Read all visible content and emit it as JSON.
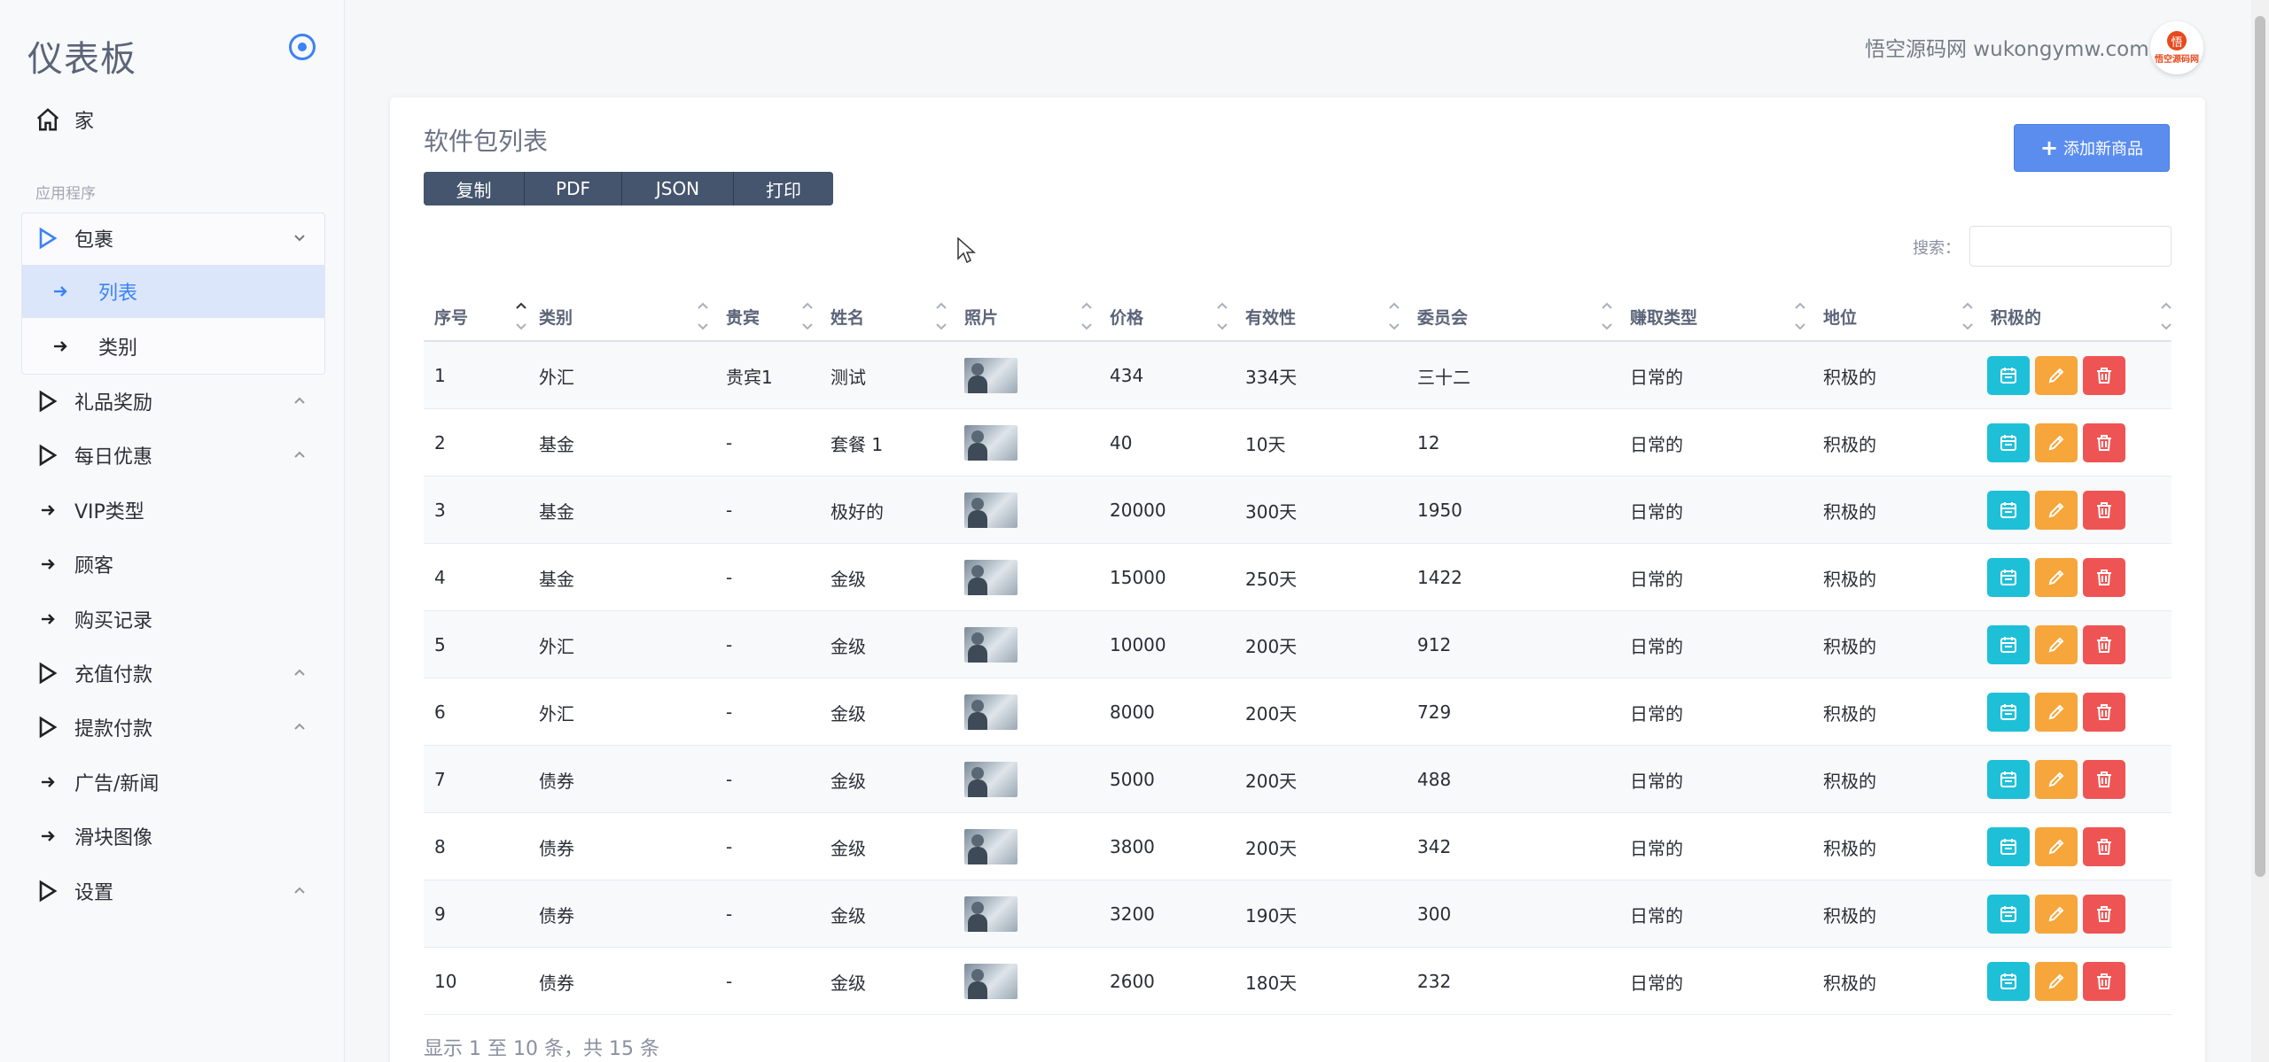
{
  "sidebar": {
    "brand": "仪表板",
    "section_label": "应用程序",
    "home": "家",
    "group_packages": "包裹",
    "sub_list": "列表",
    "sub_category": "类别",
    "items": [
      "礼品奖励",
      "每日优惠",
      "VIP类型",
      "顾客",
      "购买记录",
      "充值付款",
      "提款付款",
      "广告/新闻",
      "滑块图像",
      "设置"
    ]
  },
  "header": {
    "site_text": "悟空源码网 wukongymw.com",
    "avatar_top": "悟",
    "avatar_text": "悟空源码网"
  },
  "card": {
    "title": "软件包列表",
    "export_buttons": [
      "复制",
      "PDF",
      "JSON",
      "打印"
    ],
    "add_button": "添加新商品",
    "search_label": "搜索：",
    "footer_info": "显示 1 至 10 条，共 15 条"
  },
  "table": {
    "columns": [
      "序号",
      "类别",
      "贵宾",
      "姓名",
      "照片",
      "价格",
      "有效性",
      "委员会",
      "赚取类型",
      "地位",
      "积极的"
    ],
    "rows": [
      [
        "1",
        "外汇",
        "贵宾1",
        "测试",
        "",
        "434",
        "334天",
        "三十二",
        "日常的",
        "积极的"
      ],
      [
        "2",
        "基金",
        "-",
        "套餐 1",
        "",
        "40",
        "10天",
        "12",
        "日常的",
        "积极的"
      ],
      [
        "3",
        "基金",
        "-",
        "极好的",
        "",
        "20000",
        "300天",
        "1950",
        "日常的",
        "积极的"
      ],
      [
        "4",
        "基金",
        "-",
        "金级",
        "",
        "15000",
        "250天",
        "1422",
        "日常的",
        "积极的"
      ],
      [
        "5",
        "外汇",
        "-",
        "金级",
        "",
        "10000",
        "200天",
        "912",
        "日常的",
        "积极的"
      ],
      [
        "6",
        "外汇",
        "-",
        "金级",
        "",
        "8000",
        "200天",
        "729",
        "日常的",
        "积极的"
      ],
      [
        "7",
        "债券",
        "-",
        "金级",
        "",
        "5000",
        "200天",
        "488",
        "日常的",
        "积极的"
      ],
      [
        "8",
        "债券",
        "-",
        "金级",
        "",
        "3800",
        "200天",
        "342",
        "日常的",
        "积极的"
      ],
      [
        "9",
        "债券",
        "-",
        "金级",
        "",
        "3200",
        "190天",
        "300",
        "日常的",
        "积极的"
      ],
      [
        "10",
        "债券",
        "-",
        "金级",
        "",
        "2600",
        "180天",
        "232",
        "日常的",
        "积极的"
      ]
    ]
  },
  "colors": {
    "accent": "#3b82f6",
    "view_button": "#1ec0d8",
    "edit_button": "#f6a63a",
    "delete_button": "#ef5454"
  }
}
